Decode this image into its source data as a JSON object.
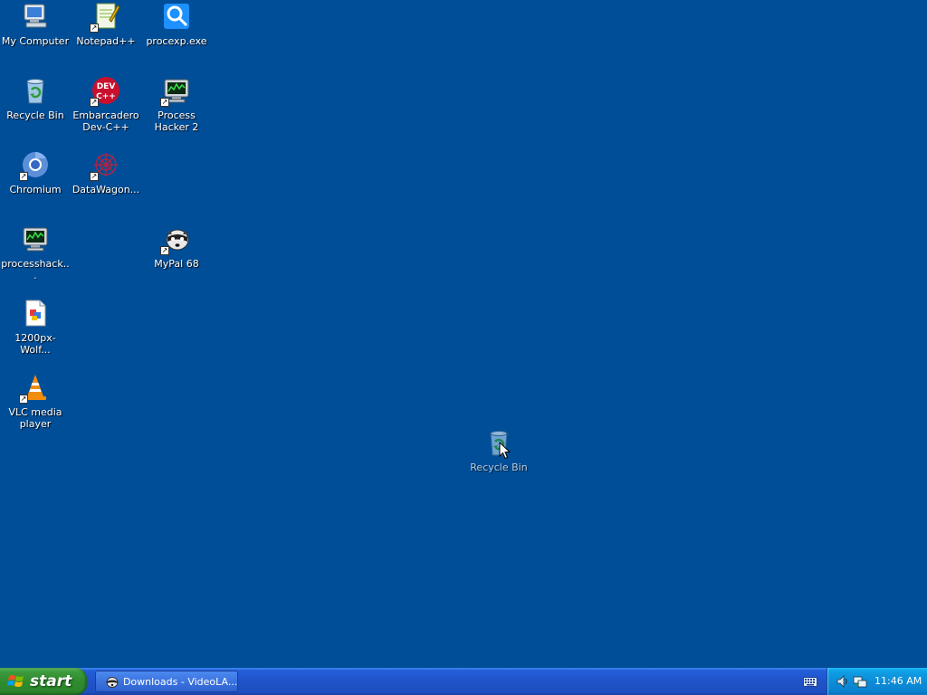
{
  "desktop": {
    "background": "#004e98",
    "icons": [
      {
        "label": "My Computer"
      },
      {
        "label": "Notepad++"
      },
      {
        "label": "procexp.exe"
      },
      {
        "label": "Recycle Bin"
      },
      {
        "label": "Embarcadero Dev-C++"
      },
      {
        "label": "Process Hacker 2"
      },
      {
        "label": "Chromium"
      },
      {
        "label": "DataWagon..."
      },
      {
        "label": "processhack..."
      },
      {
        "label": "MyPal 68"
      },
      {
        "label": "1200px-Wolf..."
      },
      {
        "label": "VLC media player"
      }
    ],
    "dragged_icon": {
      "label": "Recycle Bin"
    }
  },
  "taskbar": {
    "start_label": "start",
    "task_button": {
      "label": "Downloads - VideoLA..."
    },
    "tray": {
      "clock": "11:46 AM"
    }
  }
}
